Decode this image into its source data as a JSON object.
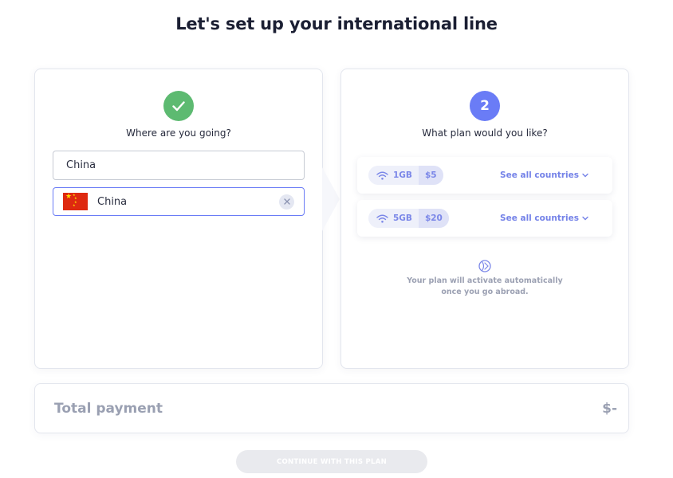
{
  "page": {
    "title": "Let's set up your international line"
  },
  "step1": {
    "label": "Where are you going?",
    "search_value": "China",
    "selected_country": "China"
  },
  "step2": {
    "number": "2",
    "label": "What plan would you like?",
    "plans": [
      {
        "data": "1GB",
        "price": "$5",
        "link": "See all countries"
      },
      {
        "data": "5GB",
        "price": "$20",
        "link": "See all countries"
      }
    ],
    "info_line1": "Your plan will activate automatically",
    "info_line2": "once you go abroad."
  },
  "total": {
    "label": "Total payment",
    "amount": "$-"
  },
  "cta": {
    "label": "CONTINUE WITH THIS PLAN"
  },
  "colors": {
    "accent": "#6a7cf6",
    "success": "#5dba71",
    "flag_red": "#de2910",
    "flag_yellow": "#ffde00"
  }
}
